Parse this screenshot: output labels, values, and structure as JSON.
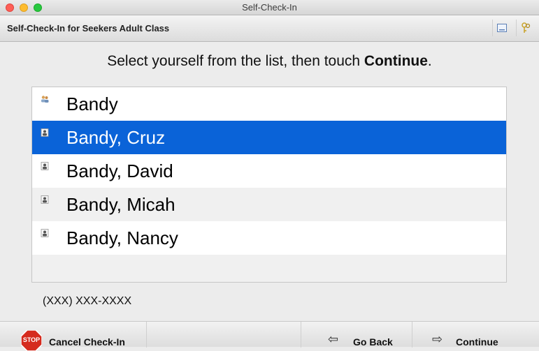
{
  "window": {
    "title": "Self-Check-In"
  },
  "header": {
    "title": "Self-Check-In for Seekers Adult Class",
    "display_icon": "display-icon",
    "keys_icon": "keys-icon"
  },
  "instruction": {
    "before": "Select yourself from the list, then touch ",
    "bold": "Continue",
    "after": "."
  },
  "list": {
    "items": [
      {
        "label": "Bandy",
        "icon": "family-icon",
        "selected": false
      },
      {
        "label": "Bandy, Cruz",
        "icon": "person-icon",
        "selected": true
      },
      {
        "label": "Bandy, David",
        "icon": "person-icon",
        "selected": false
      },
      {
        "label": "Bandy, Micah",
        "icon": "person-icon",
        "selected": false
      },
      {
        "label": "Bandy, Nancy",
        "icon": "person-icon",
        "selected": false
      }
    ]
  },
  "phone": "(XXX) XXX-XXXX",
  "footer": {
    "cancel_label": "Cancel Check-In",
    "stop_text": "STOP",
    "back_label": "Go Back",
    "continue_label": "Continue"
  },
  "colors": {
    "selected_row": "#0a63d8",
    "stop_red": "#d52b1e"
  }
}
